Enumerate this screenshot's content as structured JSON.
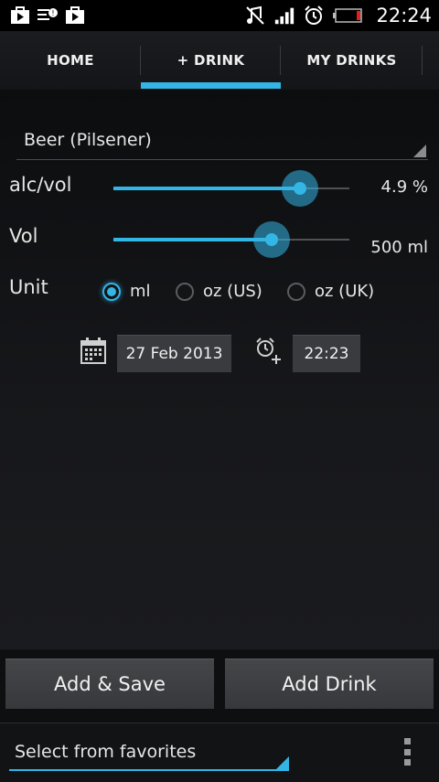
{
  "status_bar": {
    "time": "22:24",
    "icons": [
      "play-store-icon",
      "notification-icon",
      "play-store-icon",
      "mute-icon",
      "signal-icon",
      "alarm-icon",
      "battery-icon"
    ]
  },
  "tabs": [
    {
      "label": "HOME",
      "selected": false
    },
    {
      "label": "+ DRINK",
      "selected": true
    },
    {
      "label": "MY DRINKS",
      "selected": false
    }
  ],
  "drink_type": {
    "selected": "Beer (Pilsener)"
  },
  "alc_vol": {
    "label": "alc/vol",
    "value": "4.9 %",
    "slider_fraction": 0.79
  },
  "vol": {
    "label": "Vol",
    "value": "500 ml",
    "slider_fraction": 0.67
  },
  "unit": {
    "label": "Unit",
    "options": [
      {
        "label": "ml",
        "selected": true
      },
      {
        "label": "oz (US)",
        "selected": false
      },
      {
        "label": "oz (UK)",
        "selected": false
      }
    ]
  },
  "date": "27 Feb 2013",
  "time": "22:23",
  "buttons": {
    "add_save": "Add & Save",
    "add_drink": "Add Drink"
  },
  "favorites": {
    "placeholder": "Select from favorites"
  },
  "colors": {
    "accent": "#33b5e5",
    "background": "#0e0f11"
  }
}
